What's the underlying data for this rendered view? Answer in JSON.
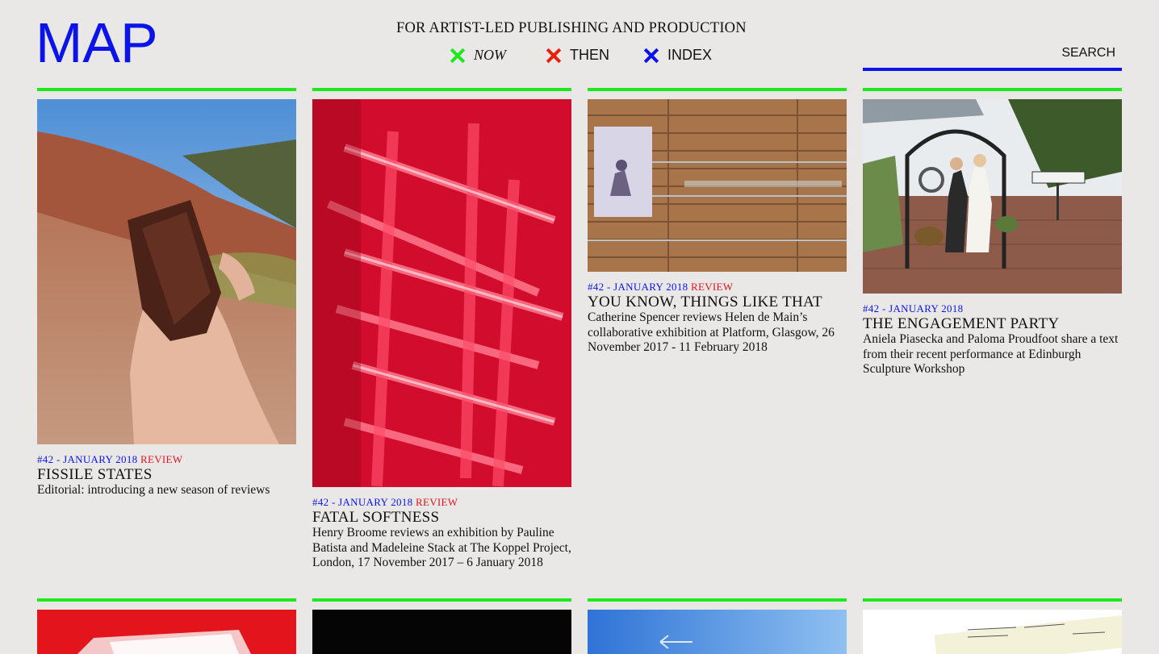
{
  "header": {
    "logo": "MAP",
    "tagline": "FOR ARTIST-LED PUBLISHING AND PRODUCTION",
    "nav": [
      {
        "label": "NOW",
        "color": "#1de91d",
        "style": "italic"
      },
      {
        "label": "THEN",
        "color": "#e8200a",
        "style": "normal"
      },
      {
        "label": "INDEX",
        "color": "#0a14e8",
        "style": "normal"
      }
    ],
    "search_label": "SEARCH"
  },
  "colors": {
    "accent_blue": "#0a14e8",
    "rule_green": "#1de91d",
    "category_red": "#e0121f",
    "background": "#e9e8e7"
  },
  "articles": [
    {
      "issue": "#42 - JANUARY 2018",
      "category": "REVIEW",
      "title": "FISSILE STATES",
      "description": "Editorial: introducing a new season of reviews"
    },
    {
      "issue": "#42 - JANUARY 2018",
      "category": "REVIEW",
      "title": "FATAL SOFTNESS",
      "description": "Henry Broome reviews an exhibition by Pauline Batista and Madeleine Stack at The Koppel Project, London, 17 November 2017 – 6 January 2018"
    },
    {
      "issue": "#42 - JANUARY 2018",
      "category": "REVIEW",
      "title": "YOU KNOW, THINGS LIKE THAT",
      "description": "Catherine Spencer reviews Helen de Main’s collaborative exhibition at Platform, Glasgow, 26 November 2017 - 11 February 2018"
    },
    {
      "issue": "#42 - JANUARY 2018",
      "category": "",
      "title": "THE ENGAGEMENT PARTY",
      "description": "Aniela Piasecka and Paloma Proudfoot share a text from their recent performance at Edinburgh Sculpture Workshop"
    }
  ]
}
